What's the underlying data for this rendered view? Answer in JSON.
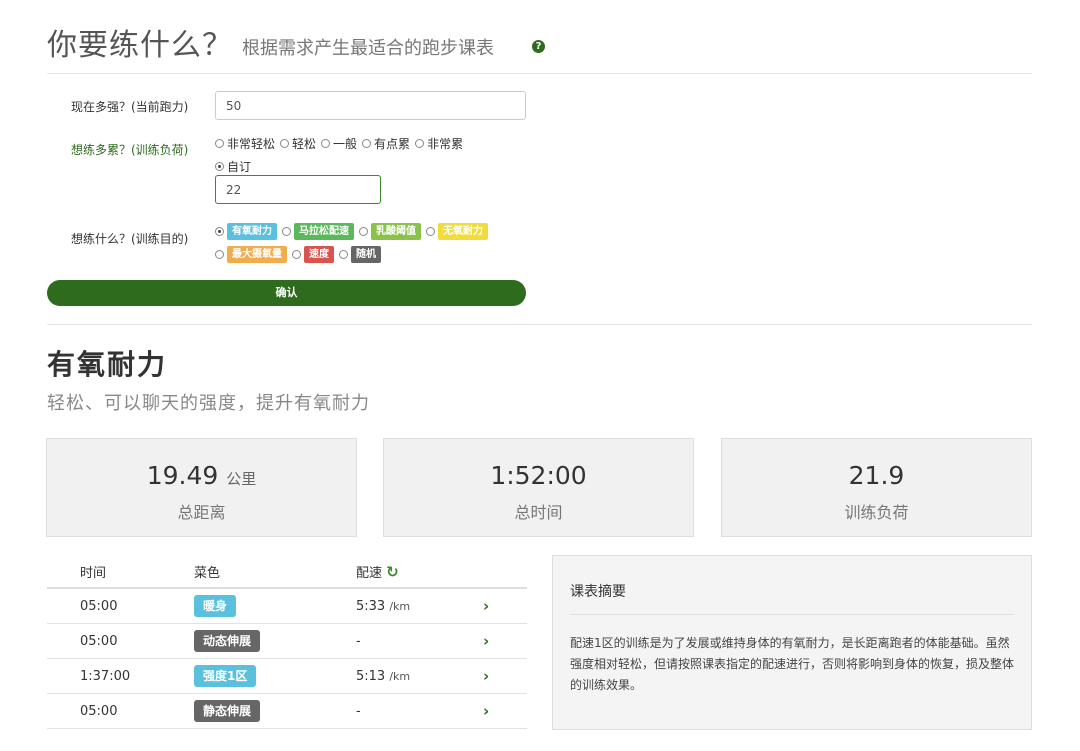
{
  "header": {
    "title": "你要练什么？",
    "subtitle": "根据需求产生最适合的跑步课表",
    "help_icon": "question-circle-icon"
  },
  "form": {
    "pace_label": "现在多强？(当前跑力)",
    "pace_value": "50",
    "load_label": "想练多累？(训练负荷)",
    "load_options": [
      "非常轻松",
      "轻松",
      "一般",
      "有点累",
      "非常累"
    ],
    "load_custom_label": "自订",
    "load_custom_value": "22",
    "goal_label": "想练什么？(训练目的)",
    "goals_row1": [
      {
        "label": "有氧耐力",
        "color": "#5bc0de",
        "selected": true
      },
      {
        "label": "马拉松配速",
        "color": "#5cb85c",
        "selected": false
      },
      {
        "label": "乳酸阈值",
        "color": "#8bc34a",
        "selected": false
      },
      {
        "label": "无氧耐力",
        "color": "#f0dc3c",
        "selected": false
      }
    ],
    "goals_row2": [
      {
        "label": "最大摄氧量",
        "color": "#f0ad4e",
        "selected": false
      },
      {
        "label": "速度",
        "color": "#d9534f",
        "selected": false
      },
      {
        "label": "随机",
        "color": "#666666",
        "selected": false
      }
    ],
    "confirm_label": "确认"
  },
  "result": {
    "title": "有氧耐力",
    "subtitle": "轻松、可以聊天的强度，提升有氧耐力",
    "stats": [
      {
        "value": "19.49",
        "unit": "公里",
        "label": "总距离"
      },
      {
        "value": "1:52:00",
        "unit": "",
        "label": "总时间"
      },
      {
        "value": "21.9",
        "unit": "",
        "label": "训练负荷"
      }
    ]
  },
  "plan": {
    "headers": {
      "time": "时间",
      "menu": "菜色",
      "pace": "配速"
    },
    "rows": [
      {
        "time": "05:00",
        "menu": "暖身",
        "color": "#5bc0de",
        "pace": "5:33",
        "unit": "/km"
      },
      {
        "time": "05:00",
        "menu": "动态伸展",
        "color": "#666666",
        "pace": "-",
        "unit": ""
      },
      {
        "time": "1:37:00",
        "menu": "强度1区",
        "color": "#5bc0de",
        "pace": "5:13",
        "unit": "/km"
      },
      {
        "time": "05:00",
        "menu": "静态伸展",
        "color": "#666666",
        "pace": "-",
        "unit": ""
      }
    ]
  },
  "summary": {
    "title": "课表摘要",
    "body": "配速1区的训练是为了发展或维持身体的有氧耐力，是长距离跑者的体能基础。虽然强度相对轻松，但请按照课表指定的配速进行，否则将影响到身体的恢复，损及整体的训练效果。"
  }
}
